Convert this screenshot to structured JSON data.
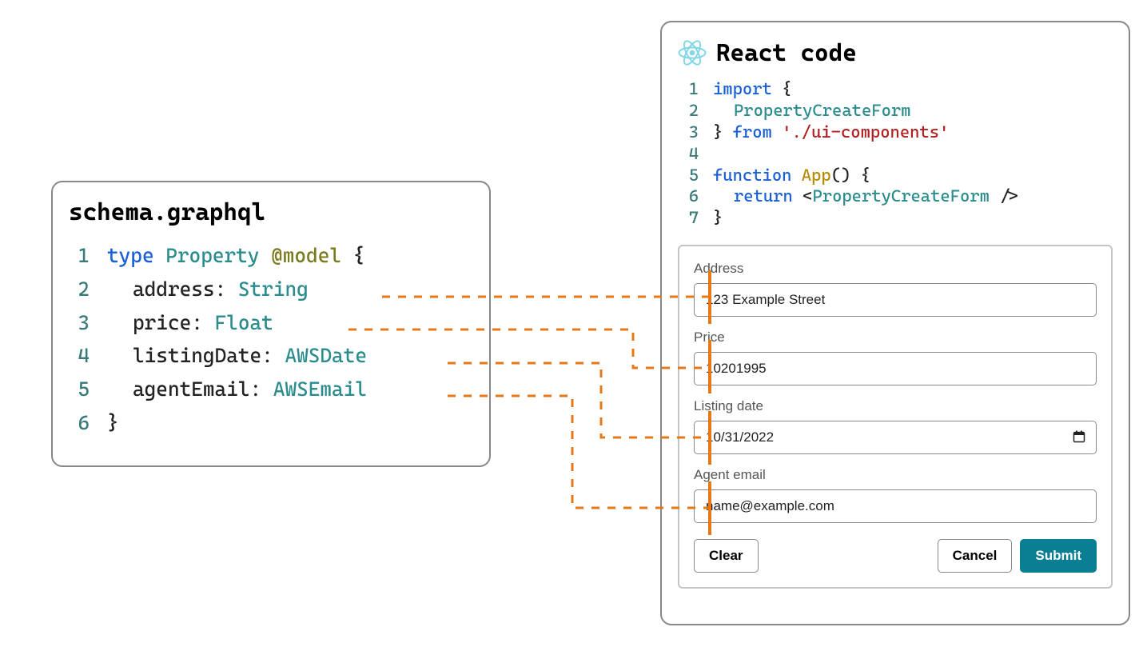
{
  "schema": {
    "title": "schema.graphql",
    "lines": [
      {
        "num": "1",
        "tokens": [
          [
            "kw",
            "type"
          ],
          [
            "",
            " "
          ],
          [
            "type",
            "Property"
          ],
          [
            "",
            " "
          ],
          [
            "ann",
            "@model"
          ],
          [
            "",
            " "
          ],
          [
            "punc",
            "{"
          ]
        ]
      },
      {
        "num": "2",
        "indent": true,
        "tokens": [
          [
            "punc",
            "address:"
          ],
          [
            "",
            " "
          ],
          [
            "type",
            "String"
          ]
        ]
      },
      {
        "num": "3",
        "indent": true,
        "tokens": [
          [
            "punc",
            "price:"
          ],
          [
            "",
            " "
          ],
          [
            "type",
            "Float"
          ]
        ]
      },
      {
        "num": "4",
        "indent": true,
        "tokens": [
          [
            "punc",
            "listingDate:"
          ],
          [
            "",
            " "
          ],
          [
            "type",
            "AWSDate"
          ]
        ]
      },
      {
        "num": "5",
        "indent": true,
        "tokens": [
          [
            "punc",
            "agentEmail:"
          ],
          [
            "",
            " "
          ],
          [
            "type",
            "AWSEmail"
          ]
        ]
      },
      {
        "num": "6",
        "tokens": [
          [
            "punc",
            "}"
          ]
        ]
      }
    ]
  },
  "react": {
    "title": "React code",
    "lines": [
      {
        "num": "1",
        "tokens": [
          [
            "kw",
            "import"
          ],
          [
            "",
            " "
          ],
          [
            "punc",
            "{"
          ]
        ]
      },
      {
        "num": "2",
        "indent": true,
        "tokens": [
          [
            "type",
            "PropertyCreateForm"
          ]
        ]
      },
      {
        "num": "3",
        "tokens": [
          [
            "punc",
            "}"
          ],
          [
            "",
            " "
          ],
          [
            "kw",
            "from"
          ],
          [
            "",
            " "
          ],
          [
            "str",
            "'./ui-components'"
          ]
        ]
      },
      {
        "num": "4",
        "tokens": []
      },
      {
        "num": "5",
        "tokens": [
          [
            "kw",
            "function"
          ],
          [
            "",
            " "
          ],
          [
            "fn",
            "App"
          ],
          [
            "punc",
            "()"
          ],
          [
            "",
            " "
          ],
          [
            "punc",
            "{"
          ]
        ]
      },
      {
        "num": "6",
        "indent": true,
        "tokens": [
          [
            "kw",
            "return"
          ],
          [
            "",
            " "
          ],
          [
            "punc",
            "<"
          ],
          [
            "tag",
            "PropertyCreateForm"
          ],
          [
            "",
            " "
          ],
          [
            "punc",
            "/>"
          ]
        ]
      },
      {
        "num": "7",
        "tokens": [
          [
            "punc",
            "}"
          ]
        ]
      }
    ]
  },
  "form": {
    "address_label": "Address",
    "address_value": "123 Example Street",
    "price_label": "Price",
    "price_value": "10201995",
    "listing_label": "Listing date",
    "listing_value": "10/31/2022",
    "agent_label": "Agent email",
    "agent_value": "name@example.com",
    "clear_label": "Clear",
    "cancel_label": "Cancel",
    "submit_label": "Submit"
  },
  "colors": {
    "connector": "#e67817"
  }
}
